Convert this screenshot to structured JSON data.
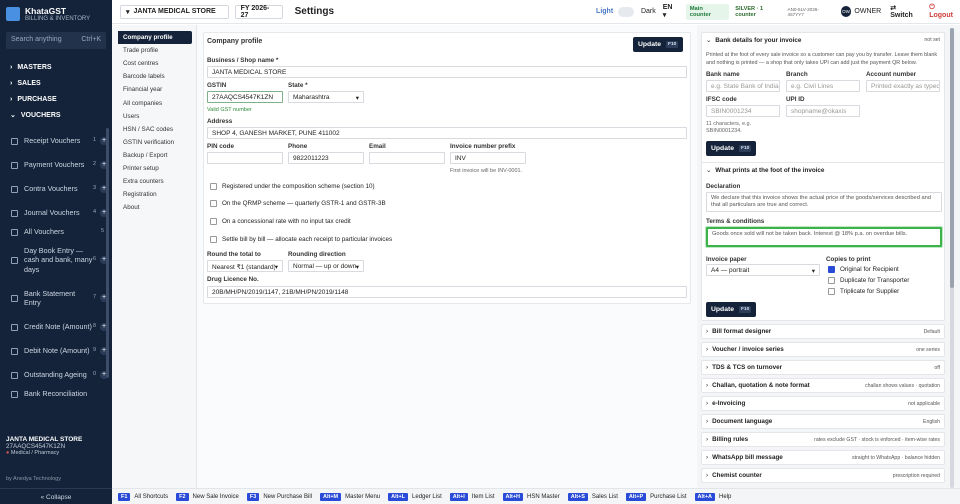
{
  "app": {
    "name": "KhataGST",
    "subtitle": "BILLING & INVENTORY",
    "search": "Search anything",
    "search_key": "Ctrl+K"
  },
  "sidebar": {
    "groups": [
      "MASTERS",
      "SALES",
      "PURCHASE",
      "VOUCHERS"
    ],
    "items": [
      {
        "label": "Receipt Vouchers",
        "num": "1"
      },
      {
        "label": "Payment Vouchers",
        "num": "2"
      },
      {
        "label": "Contra Vouchers",
        "num": "3"
      },
      {
        "label": "Journal Vouchers",
        "num": "4"
      },
      {
        "label": "All Vouchers",
        "num": "5"
      },
      {
        "label": "Day Book Entry — cash and bank, many days",
        "num": "6"
      },
      {
        "label": "Bank Statement Entry",
        "num": "7"
      },
      {
        "label": "Credit Note (Amount)",
        "num": "8"
      },
      {
        "label": "Debit Note (Amount)",
        "num": "9"
      },
      {
        "label": "Outstanding Ageing",
        "num": "0"
      },
      {
        "label": "Bank Reconciliation",
        "num": ""
      }
    ],
    "footer": {
      "company": "JANTA MEDICAL STORE",
      "gstin": "27AAQCS4547K1ZN",
      "type": "Medical / Pharmacy",
      "by": "by Anedya Technology",
      "collapse": "« Collapse"
    }
  },
  "topbar": {
    "company": "JANTA MEDICAL STORE",
    "fy": "FY 2026-27",
    "title": "Settings",
    "light": "Light",
    "dark": "Dark",
    "lang": "EN",
    "counter": "Main counter",
    "plan": "SILVER · 1 counter",
    "plan_id": "AN0-5LV-2026-457YY7",
    "role": "OWNER",
    "avatar": "OW",
    "switch": "Switch",
    "logout": "Logout"
  },
  "menu": [
    "Company profile",
    "Trade profile",
    "Cost centres",
    "Barcode labels",
    "Financial year",
    "All companies",
    "Users",
    "HSN / SAC codes",
    "GSTIN verification",
    "Backup / Export",
    "Printer setup",
    "Extra counters",
    "Registration",
    "About"
  ],
  "profile": {
    "title": "Company profile",
    "update": "Update",
    "update_key": "F10",
    "business_label": "Business / Shop name *",
    "business": "JANTA MEDICAL STORE",
    "gstin_label": "GSTIN",
    "gstin": "27AAQCS4547K1ZN",
    "gstin_valid": "Valid GST number",
    "state_label": "State *",
    "state": "Maharashtra",
    "address_label": "Address",
    "address": "SHOP 4, GANESH MARKET, PUNE 411002",
    "pin_label": "PIN code",
    "pin": "",
    "phone_label": "Phone",
    "phone": "9822011223",
    "email_label": "Email",
    "email": "",
    "prefix_label": "Invoice number prefix",
    "prefix": "INV",
    "prefix_hint": "First invoice will be INV-0001.",
    "checks": [
      "Registered under the composition scheme (section 10)",
      "On the QRMP scheme — quarterly GSTR-1 and GSTR-3B",
      "On a concessional rate with no input tax credit",
      "Settle bill by bill — allocate each receipt to particular invoices"
    ],
    "round_label": "Round the total to",
    "round": "Nearest ₹1 (standard)",
    "rdir_label": "Rounding direction",
    "rdir": "Normal — up or down",
    "dl_label": "Drug Licence No.",
    "dl": "20B/MH/PN/2019/1147, 21B/MH/PN/2019/1148"
  },
  "right": {
    "bank_title": "Bank details for your invoice",
    "bank_status": "not set",
    "bank_desc": "Printed at the foot of every sale invoice so a customer can pay you by transfer. Leave them blank and nothing is printed — a shop that only takes UPI can add just the payment QR below.",
    "bank_name_label": "Bank name",
    "bank_name_ph": "e.g. State Bank of India",
    "branch_label": "Branch",
    "branch_ph": "e.g. Civil Lines",
    "acc_label": "Account number",
    "acc_ph": "Printed exactly as typed",
    "ifsc_label": "IFSC code",
    "ifsc_ph": "SBIN0001234",
    "upi_label": "UPI ID",
    "upi_ph": "shopname@okaxis",
    "ifsc_hint": "11 characters, e.g. SBIN0001234.",
    "update": "Update",
    "update_key": "F10",
    "foot_title": "What prints at the foot of the invoice",
    "decl_label": "Declaration",
    "decl": "We declare that this invoice shows the actual price of the goods/services described and that all particulars are true and correct.",
    "terms_label": "Terms & conditions",
    "terms": "Goods once sold will not be taken back. Interest @ 18% p.a. on overdue bills.",
    "paper_label": "Invoice paper",
    "paper": "A4 — portrait",
    "copies_label": "Copies to print",
    "copies": [
      {
        "label": "Original for Recipient",
        "on": true
      },
      {
        "label": "Duplicate for Transporter",
        "on": false
      },
      {
        "label": "Triplicate for Supplier",
        "on": false
      }
    ],
    "sections": [
      {
        "t": "Bill format designer",
        "v": "Default"
      },
      {
        "t": "Voucher / invoice series",
        "v": "one series"
      },
      {
        "t": "TDS & TCS on turnover",
        "v": "off"
      },
      {
        "t": "Challan, quotation & note format",
        "v": "challan shows values · quotation"
      },
      {
        "t": "e-Invoicing",
        "v": "not applicable"
      },
      {
        "t": "Document language",
        "v": "English"
      },
      {
        "t": "Billing rules",
        "v": "rates exclude GST · stock is enforced · item-wise rates"
      },
      {
        "t": "WhatsApp bill message",
        "v": "straight to WhatsApp · balance hidden"
      },
      {
        "t": "Chemist counter",
        "v": "prescription required"
      }
    ]
  },
  "bottombar": [
    {
      "k": "F1",
      "t": "All Shortcuts"
    },
    {
      "k": "F2",
      "t": "New Sale Invoice"
    },
    {
      "k": "F3",
      "t": "New Purchase Bill"
    },
    {
      "k": "Alt+M",
      "t": "Master Menu"
    },
    {
      "k": "Alt+L",
      "t": "Ledger List"
    },
    {
      "k": "Alt+I",
      "t": "Item List"
    },
    {
      "k": "Alt+H",
      "t": "HSN Master"
    },
    {
      "k": "Alt+S",
      "t": "Sales List"
    },
    {
      "k": "Alt+P",
      "t": "Purchase List"
    },
    {
      "k": "Alt+A",
      "t": "Help"
    }
  ]
}
